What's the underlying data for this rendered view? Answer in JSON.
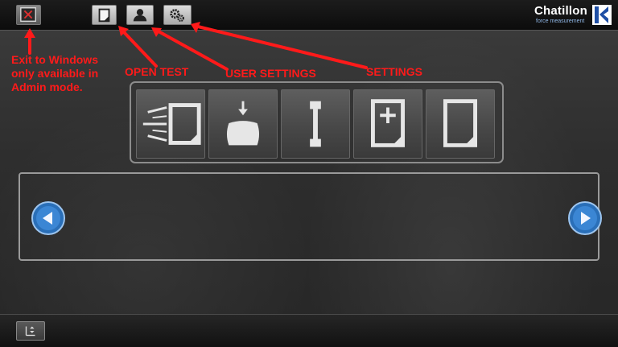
{
  "header": {
    "brand_name": "Chatillon",
    "brand_tagline": "force measurement"
  },
  "toolbar": {
    "exit_icon": "exit-windows-icon",
    "open_test_icon": "document-icon",
    "user_settings_icon": "user-icon",
    "settings_icon": "gears-icon"
  },
  "annotations": {
    "exit_line1": "Exit to Windows",
    "exit_line2": "only available in",
    "exit_line3": "Admin mode.",
    "open_test": "OPEN TEST",
    "user_settings": "USER SETTINGS",
    "settings": "SETTINGS",
    "color": "#ff1a1a"
  },
  "test_tiles": [
    {
      "icon": "quick-test-icon"
    },
    {
      "icon": "compression-test-icon"
    },
    {
      "icon": "tensile-test-icon"
    },
    {
      "icon": "new-test-icon"
    },
    {
      "icon": "blank-test-icon"
    }
  ],
  "carousel": {
    "prev_icon": "arrow-left-icon",
    "next_icon": "arrow-right-icon"
  },
  "footer": {
    "button_icon": "panel-toggle-icon"
  }
}
